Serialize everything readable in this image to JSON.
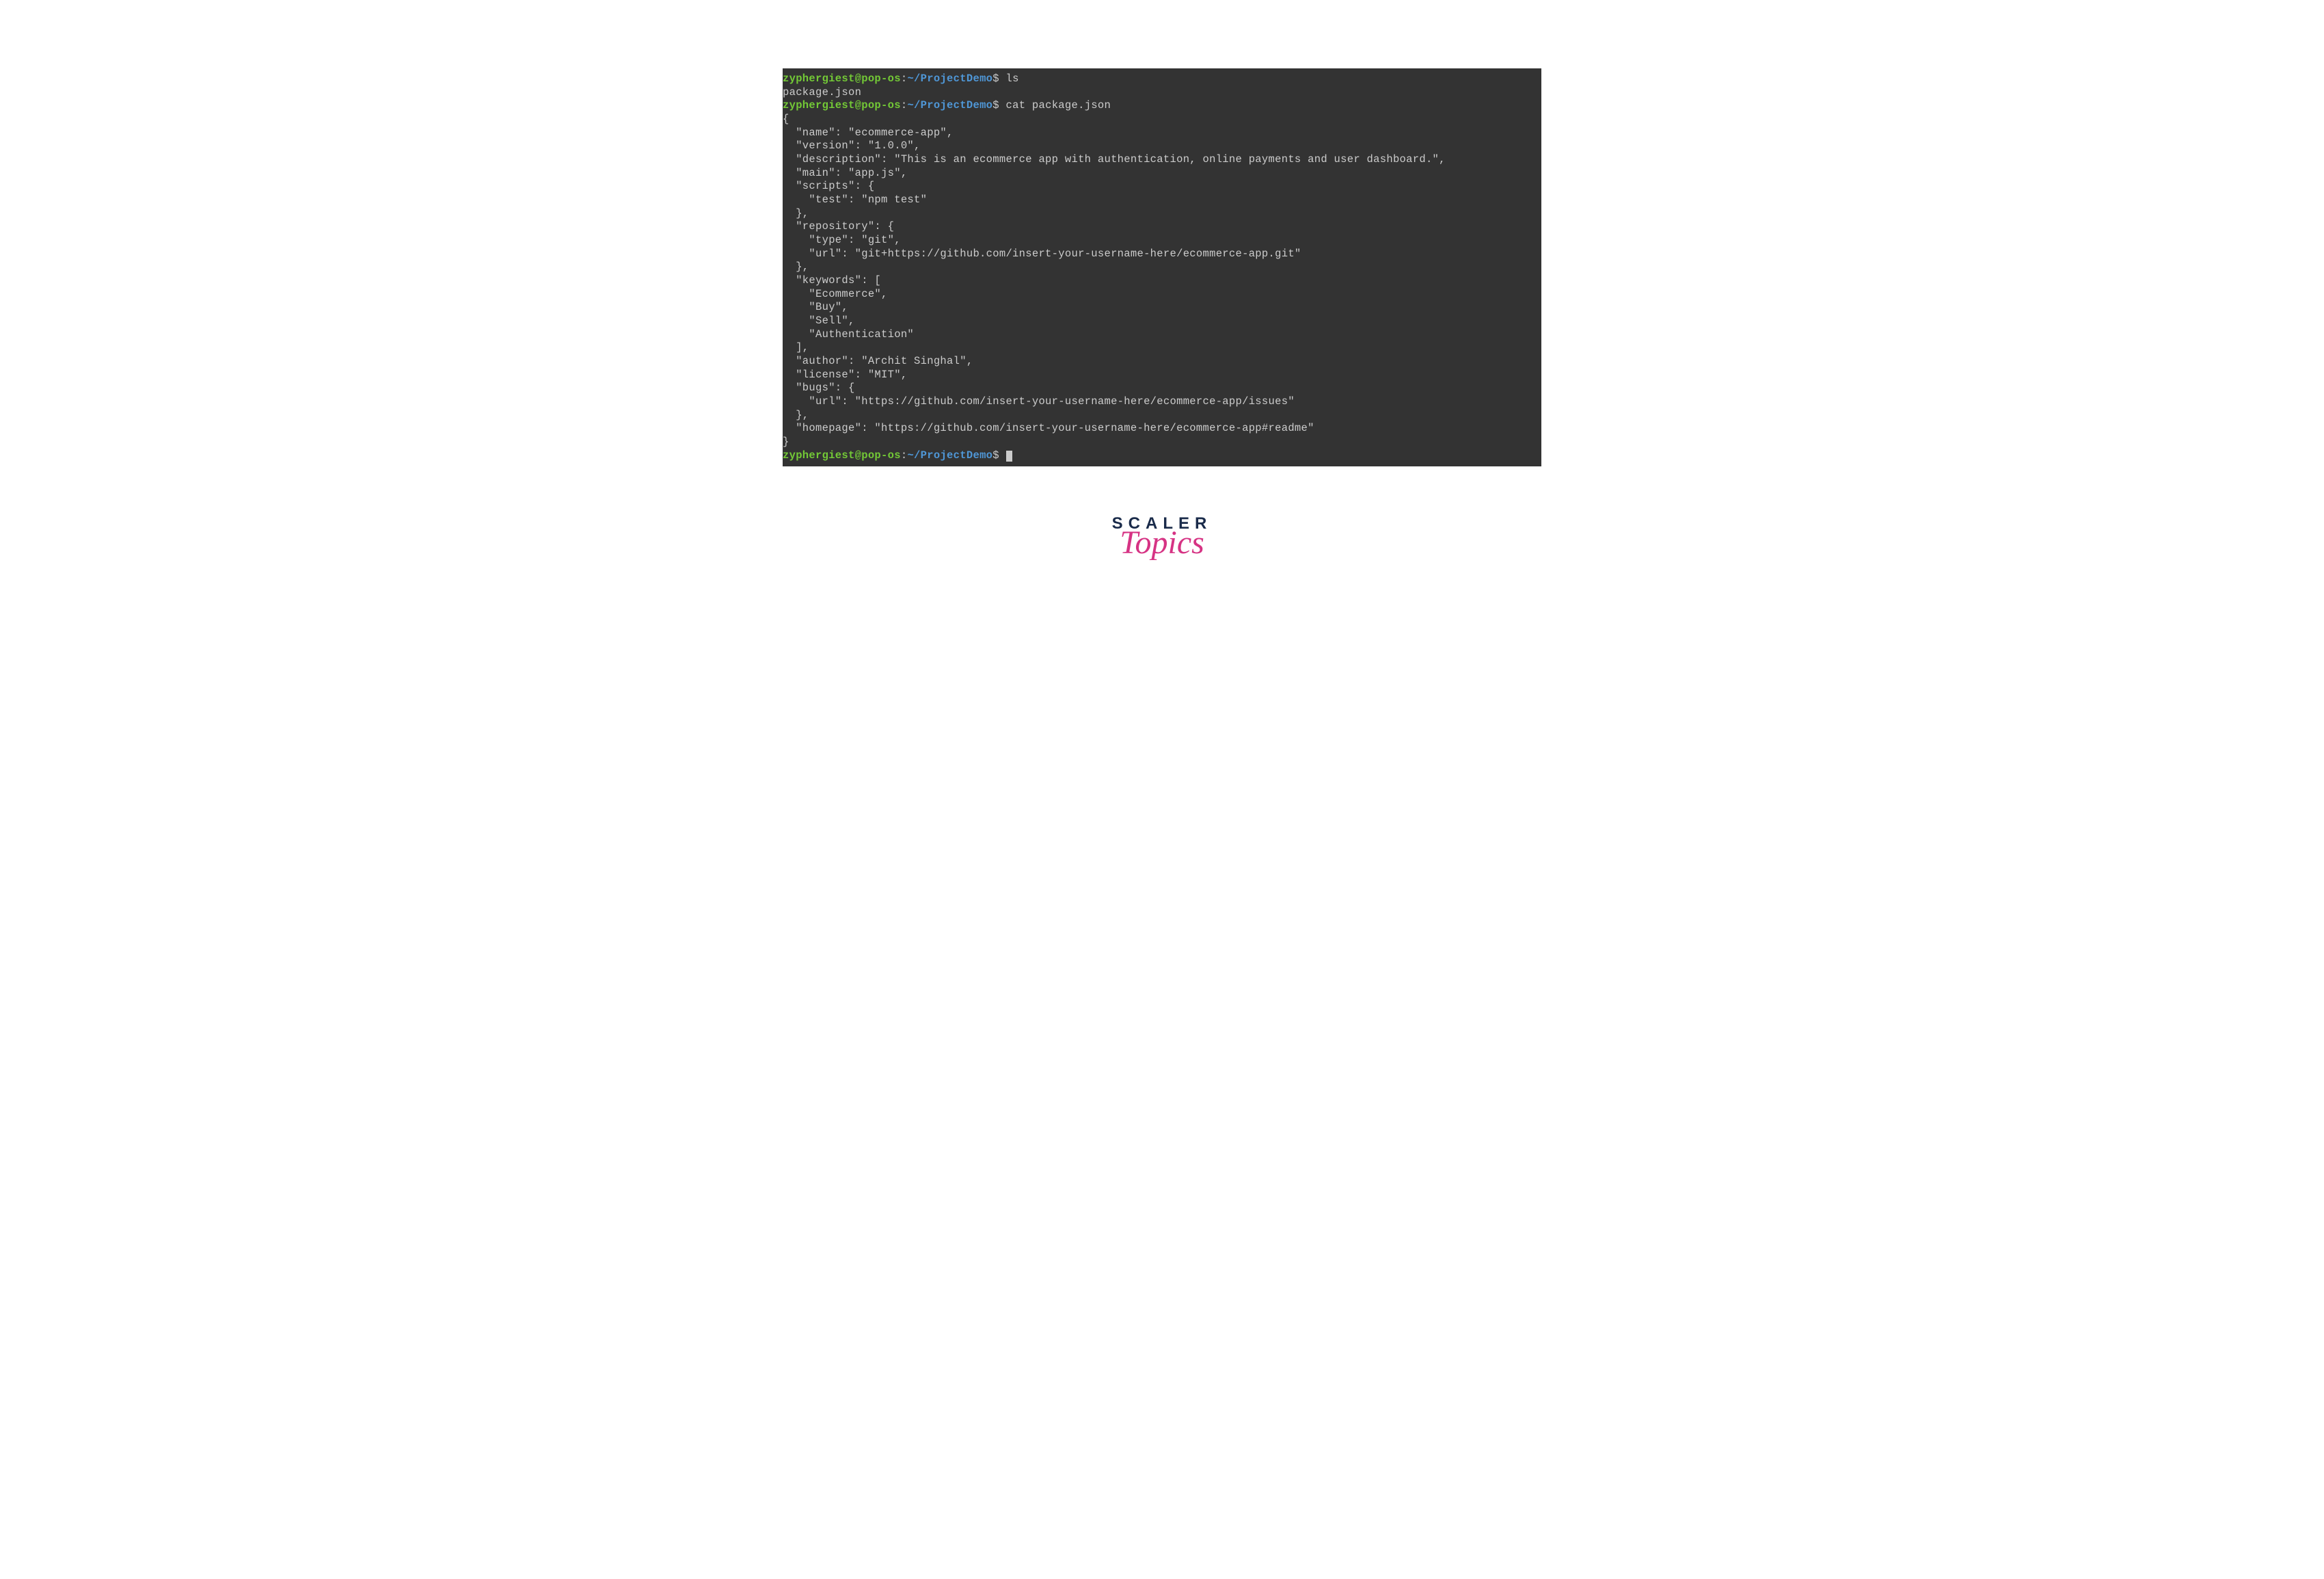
{
  "prompt": {
    "user": "zyphergiest",
    "at": "@",
    "host": "pop-os",
    "colon": ":",
    "path": "~/ProjectDemo",
    "dollar": "$"
  },
  "cmd1": " ls",
  "out1": "package.json",
  "cmd2": " cat package.json",
  "json": {
    "l01": "{",
    "l02": "  \"name\": \"ecommerce-app\",",
    "l03": "  \"version\": \"1.0.0\",",
    "l04": "  \"description\": \"This is an ecommerce app with authentication, online payments and user dashboard.\",",
    "l05": "  \"main\": \"app.js\",",
    "l06": "  \"scripts\": {",
    "l07": "    \"test\": \"npm test\"",
    "l08": "  },",
    "l09": "  \"repository\": {",
    "l10": "    \"type\": \"git\",",
    "l11": "    \"url\": \"git+https://github.com/insert-your-username-here/ecommerce-app.git\"",
    "l12": "  },",
    "l13": "  \"keywords\": [",
    "l14": "    \"Ecommerce\",",
    "l15": "    \"Buy\",",
    "l16": "    \"Sell\",",
    "l17": "    \"Authentication\"",
    "l18": "  ],",
    "l19": "  \"author\": \"Archit Singhal\",",
    "l20": "  \"license\": \"MIT\",",
    "l21": "  \"bugs\": {",
    "l22": "    \"url\": \"https://github.com/insert-your-username-here/ecommerce-app/issues\"",
    "l23": "  },",
    "l24": "  \"homepage\": \"https://github.com/insert-your-username-here/ecommerce-app#readme\"",
    "l25": "}"
  },
  "logo": {
    "scaler": "SCALER",
    "topics": "Topics"
  }
}
